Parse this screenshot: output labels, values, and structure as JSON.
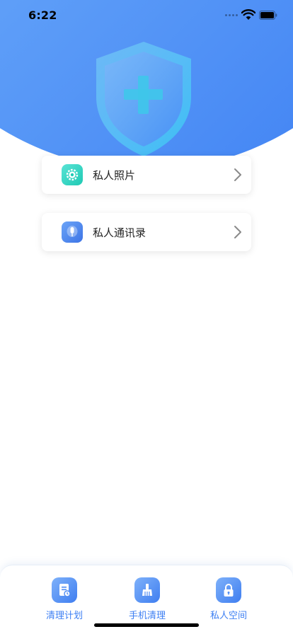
{
  "status_bar": {
    "time": "6:22"
  },
  "header": {
    "shield_icon": "shield-plus-icon",
    "gradient_colors": [
      "#9dc6fb",
      "#5f9ff8",
      "#3d7ff3"
    ]
  },
  "menu": {
    "items": [
      {
        "label": "私人照片",
        "icon": "photo-gear-icon",
        "color": "#1fcab4"
      },
      {
        "label": "私人通讯录",
        "icon": "microphone-icon",
        "color": "#3d74e6"
      }
    ]
  },
  "tab_bar": {
    "accent_color": "#3d7ff3",
    "tabs": [
      {
        "label": "清理计划",
        "icon": "document-clock-icon"
      },
      {
        "label": "手机清理",
        "icon": "brush-icon"
      },
      {
        "label": "私人空间",
        "icon": "lock-icon"
      }
    ]
  }
}
